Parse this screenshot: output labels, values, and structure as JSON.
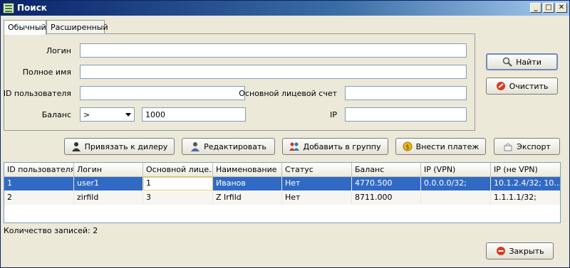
{
  "window": {
    "title": "Поиск",
    "minimize": "_",
    "maximize": "□",
    "close": "✕"
  },
  "tabs": [
    {
      "label": "Обычный",
      "active": true
    },
    {
      "label": "Расширенный",
      "active": false
    }
  ],
  "form": {
    "login_label": "Логин",
    "login_value": "",
    "fullname_label": "Полное имя",
    "fullname_value": "",
    "userid_label": "ID пользователя",
    "userid_value": "",
    "account_label": "Основной лицевой счет",
    "account_value": "",
    "balance_label": "Баланс",
    "balance_op": ">",
    "balance_value": "1000",
    "ip_label": "IP",
    "ip_value": ""
  },
  "side_buttons": {
    "find": "Найти",
    "clear": "Очистить",
    "close": "Закрыть"
  },
  "toolbar": {
    "bind_dealer": "Привязать к дилеру",
    "edit": "Редактировать",
    "add_group": "Добавить в группу",
    "payment": "Внести платеж",
    "export": "Экспорт"
  },
  "table": {
    "columns": [
      "ID пользователя",
      "Логин",
      "Основной лице...",
      "Наименование",
      "Статус",
      "Баланс",
      "IP (VPN)",
      "IP (не VPN)"
    ],
    "rows": [
      [
        "1",
        "user1",
        "1",
        "Иванов",
        "Нет",
        "4770.500",
        "0.0.0.0/32;",
        "10.1.2.4/32; 10...."
      ],
      [
        "2",
        "zirfild",
        "3",
        "Z Irfild",
        "Нет",
        "8711.000",
        "",
        "1.1.1.1/32;"
      ]
    ],
    "selected_row": 0
  },
  "status": {
    "record_count": "Количество записей: 2"
  },
  "colors": {
    "selection": "#316ac5",
    "title_start": "#0a246a",
    "title_end": "#a6caf0"
  }
}
